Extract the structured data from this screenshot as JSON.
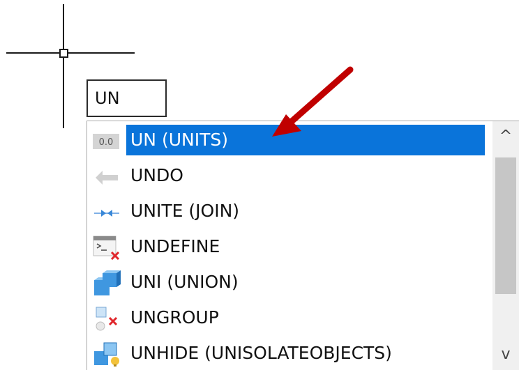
{
  "command_input": {
    "value": "UN"
  },
  "autocomplete": {
    "items": [
      {
        "label": "UN (UNITS)",
        "icon": "units-icon",
        "icon_text": "0.0",
        "selected": true
      },
      {
        "label": "UNDO",
        "icon": "undo-arrow-icon",
        "selected": false
      },
      {
        "label": "UNITE (JOIN)",
        "icon": "join-icon",
        "selected": false
      },
      {
        "label": "UNDEFINE",
        "icon": "undefine-command-icon",
        "selected": false
      },
      {
        "label": "UNI (UNION)",
        "icon": "union-solid-icon",
        "selected": false
      },
      {
        "label": "UNGROUP",
        "icon": "ungroup-icon",
        "selected": false
      },
      {
        "label": "UNHIDE (UNISOLATEOBJECTS)",
        "icon": "unhide-objects-icon",
        "selected": false
      }
    ]
  },
  "scrollbar": {
    "up_glyph": "^",
    "down_glyph": "v"
  },
  "colors": {
    "selection": "#0a74da",
    "annotation_arrow": "#c00000"
  }
}
